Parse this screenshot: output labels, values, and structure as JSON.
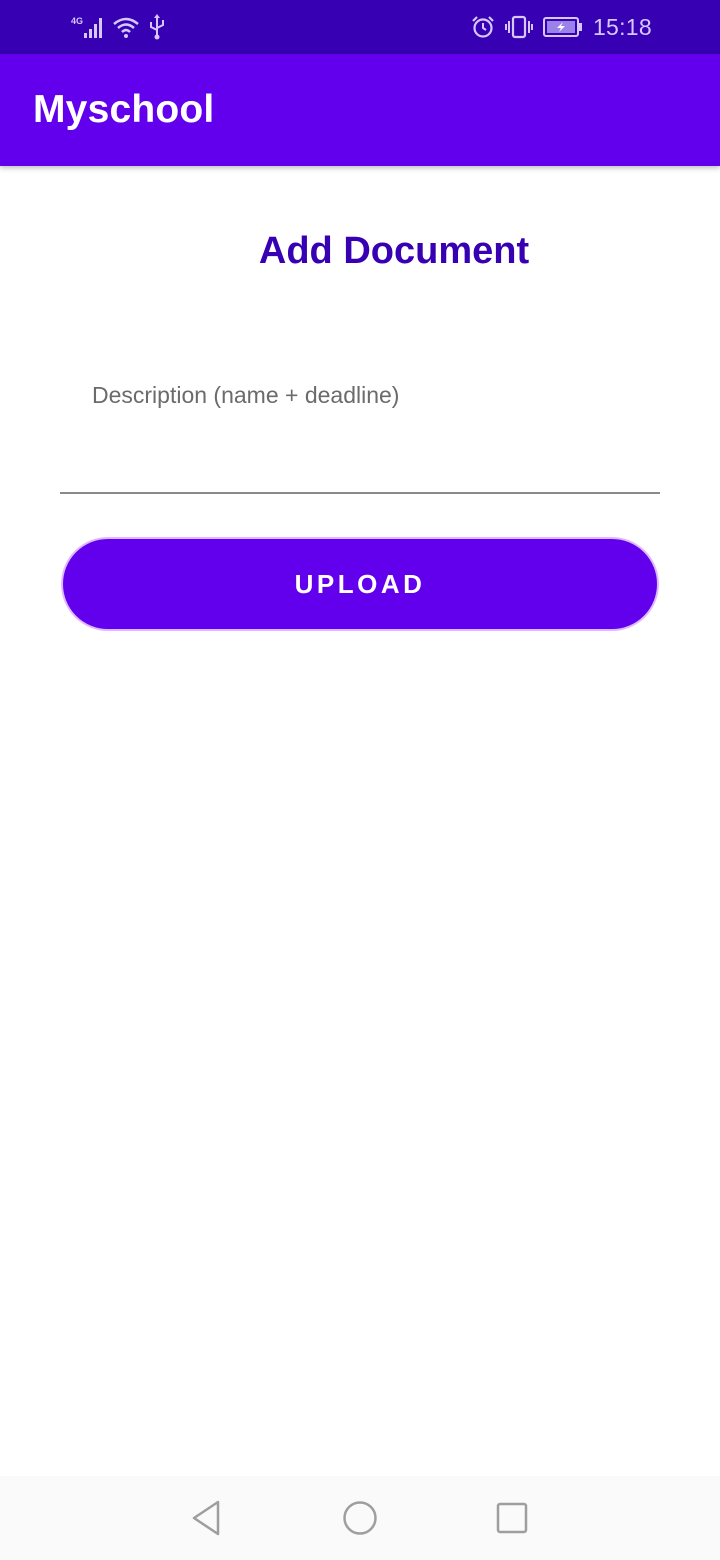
{
  "status_bar": {
    "network_label": "4G",
    "time": "15:18",
    "icons": {
      "signal": "cellular-signal-icon",
      "wifi": "wifi-icon",
      "usb": "usb-icon",
      "alarm": "alarm-icon",
      "vibrate": "vibrate-icon",
      "battery": "battery-charging-icon"
    },
    "colors": {
      "background": "#3700b3",
      "foreground": "#d6c8ff"
    }
  },
  "app_bar": {
    "title": "Myschool",
    "color": "#6200ee"
  },
  "main": {
    "heading": "Add Document",
    "heading_color": "#3700b3",
    "description_field": {
      "label": "Description (name + deadline)",
      "value": ""
    },
    "upload_button": {
      "label": "UPLOAD",
      "color": "#6200ee"
    }
  },
  "nav_bar": {
    "back": "back-triangle-icon",
    "home": "home-circle-icon",
    "recent": "recent-apps-square-icon"
  }
}
